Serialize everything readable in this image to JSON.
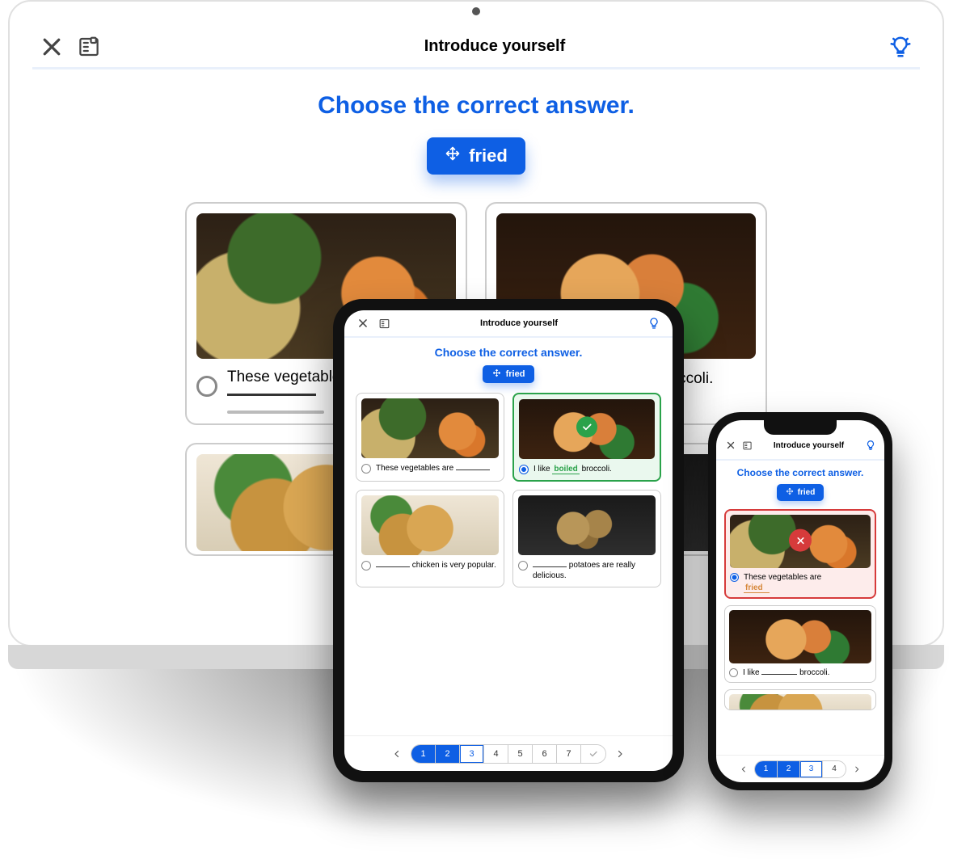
{
  "header": {
    "title": "Introduce yourself"
  },
  "instruction": "Choose the correct answer.",
  "chip": {
    "label": "fried"
  },
  "answers": {
    "veg_prefix": "These vegetables are",
    "shrimp_prefix": "I like",
    "shrimp_suffix": "broccoli.",
    "shrimp_filled": "boiled",
    "chicken_prefix_blank_then": "chicken is very popular.",
    "potato_prefix_blank_then": "potatoes are really delicious.",
    "phone_wrong_prefix": "These vegetables are",
    "phone_wrong_filled": "fried",
    "phone_shrimp_prefix": "I like",
    "phone_shrimp_suffix": "broccoli."
  },
  "pager": {
    "tablet": [
      "1",
      "2",
      "3",
      "4",
      "5",
      "6",
      "7"
    ],
    "phone": [
      "1",
      "2",
      "3",
      "4"
    ]
  }
}
